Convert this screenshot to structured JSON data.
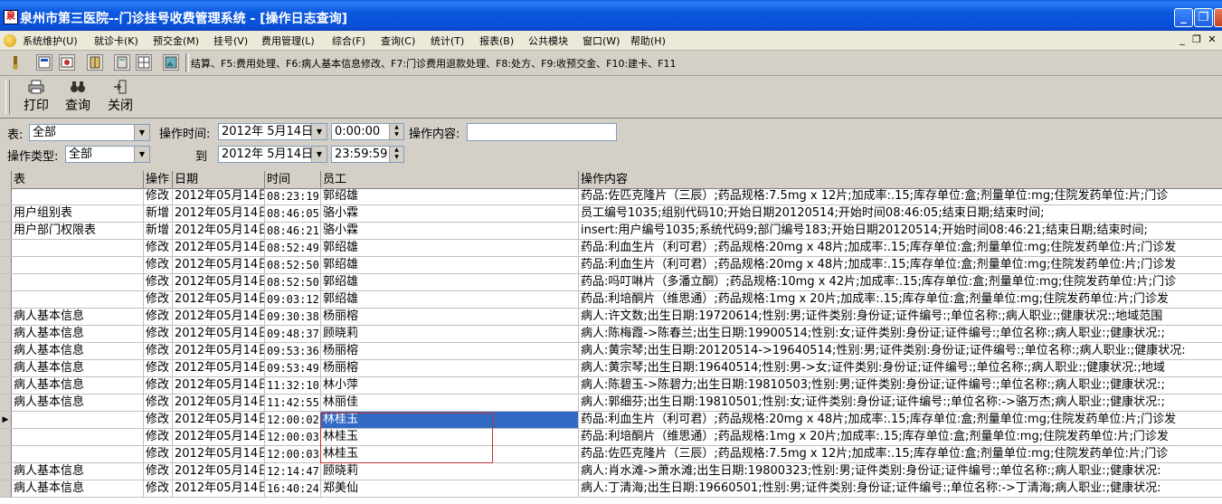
{
  "window": {
    "title": "泉州市第三医院--门诊挂号收费管理系统 - [操作日志查询]",
    "buttons": {
      "minimize": "_",
      "restore": "❐",
      "close": "✕"
    }
  },
  "menubar": {
    "items": [
      "系统维护(U)",
      "就诊卡(K)",
      "预交金(M)",
      "挂号(V)",
      "费用管理(L)",
      "综合(F)",
      "查询(C)",
      "统计(T)",
      "报表(B)",
      "公共模块",
      "窗口(W)",
      "帮助(H)"
    ],
    "mdi_buttons": [
      "_",
      "❐",
      "✕"
    ]
  },
  "toolbar1": {
    "shortcuts_text": "结算、F5:费用处理、F6:病人基本信息修改、F7:门诊费用退款处理、F8:处方、F9:收预交金、F10:建卡、F11"
  },
  "toolbar2": {
    "print": "打印",
    "query": "查询",
    "close": "关闭"
  },
  "filters": {
    "table_label": "表:",
    "table_value": "全部",
    "optype_label": "操作类型:",
    "optype_value": "全部",
    "optime_label": "操作时间:",
    "to_label": "到",
    "date_from": "2012年 5月14日",
    "time_from": "0:00:00",
    "date_to": "2012年 5月14日",
    "time_to": "23:59:59",
    "content_label": "操作内容:",
    "content_value": ""
  },
  "grid": {
    "columns": [
      "表",
      "操作",
      "日期",
      "时间",
      "员工",
      "操作内容"
    ],
    "rows": [
      [
        "",
        "修改",
        "2012年05月14日",
        "08:23:19",
        "郭绍雄",
        "药品:佐匹克隆片（三辰）;药品规格:7.5mg x 12片;加成率:.15;库存单位:盒;剂量单位:mg;住院发药单位:片;门诊"
      ],
      [
        "用户组别表",
        "新增",
        "2012年05月14日",
        "08:46:05",
        "骆小霖",
        "员工编号1035;组别代码10;开始日期20120514;开始时间08:46:05;结束日期;结束时间;"
      ],
      [
        "用户部门权限表",
        "新增",
        "2012年05月14日",
        "08:46:21",
        "骆小霖",
        "insert:用户编号1035;系统代码9;部门编号183;开始日期20120514;开始时间08:46:21;结束日期;结束时间;"
      ],
      [
        "",
        "修改",
        "2012年05月14日",
        "08:52:49",
        "郭绍雄",
        "药品:利血生片（利可君）;药品规格:20mg x 48片;加成率:.15;库存单位:盒;剂量单位:mg;住院发药单位:片;门诊发"
      ],
      [
        "",
        "修改",
        "2012年05月14日",
        "08:52:50",
        "郭绍雄",
        "药品:利血生片（利可君）;药品规格:20mg x 48片;加成率:.15;库存单位:盒;剂量单位:mg;住院发药单位:片;门诊发"
      ],
      [
        "",
        "修改",
        "2012年05月14日",
        "08:52:50",
        "郭绍雄",
        "药品:吗叮啉片（多潘立酮）;药品规格:10mg x 42片;加成率:.15;库存单位:盒;剂量单位:mg;住院发药单位:片;门诊"
      ],
      [
        "",
        "修改",
        "2012年05月14日",
        "09:03:12",
        "郭绍雄",
        "药品:利培酮片（维思通）;药品规格:1mg x 20片;加成率:.15;库存单位:盒;剂量单位:mg;住院发药单位:片;门诊发"
      ],
      [
        "病人基本信息",
        "修改",
        "2012年05月14日",
        "09:30:38",
        "杨丽榕",
        "病人:许文数;出生日期:19720614;性别:男;证件类别:身份证;证件编号:;单位名称:;病人职业:;健康状况:;地域范围"
      ],
      [
        "病人基本信息",
        "修改",
        "2012年05月14日",
        "09:48:37",
        "顾晓莉",
        "病人:陈梅霞->陈春兰;出生日期:19900514;性别:女;证件类别:身份证;证件编号:;单位名称:;病人职业:;健康状况:;"
      ],
      [
        "病人基本信息",
        "修改",
        "2012年05月14日",
        "09:53:36",
        "杨丽榕",
        "病人:黄宗琴;出生日期:20120514->19640514;性别:男;证件类别:身份证;证件编号:;单位名称:;病人职业:;健康状况:"
      ],
      [
        "病人基本信息",
        "修改",
        "2012年05月14日",
        "09:53:49",
        "杨丽榕",
        "病人:黄宗琴;出生日期:19640514;性别:男->女;证件类别:身份证;证件编号:;单位名称:;病人职业:;健康状况:;地域"
      ],
      [
        "病人基本信息",
        "修改",
        "2012年05月14日",
        "11:32:10",
        "林小萍",
        "病人:陈碧玉->陈碧力;出生日期:19810503;性别:男;证件类别:身份证;证件编号:;单位名称:;病人职业:;健康状况:;"
      ],
      [
        "病人基本信息",
        "修改",
        "2012年05月14日",
        "11:42:55",
        "林丽佳",
        "病人:郭细芬;出生日期:19810501;性别:女;证件类别:身份证;证件编号:;单位名称:->骆万杰;病人职业:;健康状况:;"
      ],
      [
        "",
        "修改",
        "2012年05月14日",
        "12:00:02",
        "林桂玉",
        "药品:利血生片（利可君）;药品规格:20mg x 48片;加成率:.15;库存单位:盒;剂量单位:mg;住院发药单位:片;门诊发"
      ],
      [
        "",
        "修改",
        "2012年05月14日",
        "12:00:03",
        "林桂玉",
        "药品:利培酮片（维思通）;药品规格:1mg x 20片;加成率:.15;库存单位:盒;剂量单位:mg;住院发药单位:片;门诊发"
      ],
      [
        "",
        "修改",
        "2012年05月14日",
        "12:00:03",
        "林桂玉",
        "药品:佐匹克隆片（三辰）;药品规格:7.5mg x 12片;加成率:.15;库存单位:盒;剂量单位:mg;住院发药单位:片;门诊"
      ],
      [
        "病人基本信息",
        "修改",
        "2012年05月14日",
        "12:14:47",
        "顾晓莉",
        "病人:肖水滩->萧水滩;出生日期:19800323;性别:男;证件类别:身份证;证件编号:;单位名称:;病人职业:;健康状况:"
      ],
      [
        "病人基本信息",
        "修改",
        "2012年05月14日",
        "16:40:24",
        "郑美仙",
        "病人:丁清海;出生日期:19660501;性别:男;证件类别:身份证;证件编号:;单位名称:->丁清海;病人职业:;健康状况:"
      ]
    ],
    "current_row_marker": "▶"
  }
}
